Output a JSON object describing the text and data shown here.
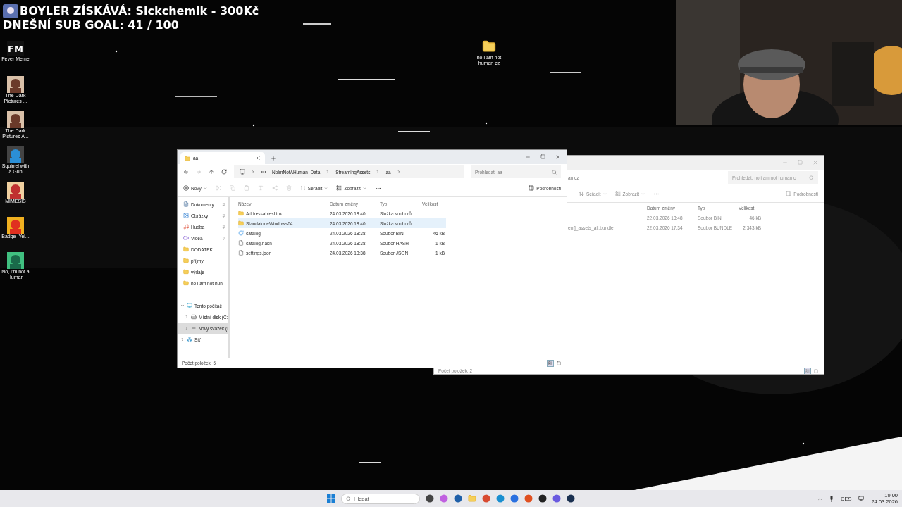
{
  "stream_overlay": {
    "donation_line": "BOYLER ZÍSKÁVÁ: Sickchemik - 300Kč",
    "sub_goal": "DNEŠNÍ SUB GOAL: 41 / 100"
  },
  "desktop_icons": [
    {
      "label": "Fever Meme",
      "kind": "text_logo",
      "logo_text": "FM"
    },
    {
      "label": "The Dark Pictures ...",
      "kind": "picture"
    },
    {
      "label": "The Dark Pictures A...",
      "kind": "picture"
    },
    {
      "label": "Squirrel with a Gun",
      "kind": "picture"
    },
    {
      "label": "MIMESIS",
      "kind": "picture"
    },
    {
      "label": "Badge_Yel...",
      "kind": "picture"
    },
    {
      "label": "No, I'm not a Human",
      "kind": "picture"
    }
  ],
  "desktop_folder": {
    "label": "no i am not human cz"
  },
  "front_window": {
    "tab_title": "aa",
    "breadcrumb": [
      "NoImNotAHuman_Data",
      "StreamingAssets",
      "aa"
    ],
    "search_placeholder": "Prohledat: aa",
    "toolbar": {
      "new": "Nový",
      "sort": "Seřadit",
      "view": "Zobrazit",
      "details": "Podrobnosti"
    },
    "quick_access": [
      {
        "label": "Dokumenty",
        "kind": "documents",
        "pinned": true
      },
      {
        "label": "Obrázky",
        "kind": "pictures",
        "pinned": true
      },
      {
        "label": "Hudba",
        "kind": "music",
        "pinned": true
      },
      {
        "label": "Videa",
        "kind": "videos",
        "pinned": true
      },
      {
        "label": "DODATEK",
        "kind": "folder",
        "pinned": false
      },
      {
        "label": "příjmy",
        "kind": "folder",
        "pinned": false
      },
      {
        "label": "výdaje",
        "kind": "folder",
        "pinned": false
      },
      {
        "label": "no i am not hun",
        "kind": "folder",
        "pinned": false
      }
    ],
    "tree": [
      {
        "label": "Tento počítač",
        "kind": "pc",
        "expanded": true,
        "selected": false,
        "children": [
          {
            "label": "Místní disk (C:",
            "kind": "drive",
            "expanded": false,
            "selected": false
          },
          {
            "label": "Nový svazek (I",
            "kind": "volume",
            "expanded": false,
            "selected": true
          }
        ]
      },
      {
        "label": "Síť",
        "kind": "network",
        "expanded": false,
        "selected": false
      }
    ],
    "columns": [
      "Název",
      "Datum změny",
      "Typ",
      "Velikost"
    ],
    "rows": [
      {
        "name": "AddressablesLink",
        "kind": "folder",
        "date": "24.03.2026 18:40",
        "type": "Složka souborů",
        "size": "",
        "selected": false
      },
      {
        "name": "StandaloneWindows64",
        "kind": "folder",
        "date": "24.03.2026 18:40",
        "type": "Složka souborů",
        "size": "",
        "selected": true
      },
      {
        "name": "catalog",
        "kind": "bin",
        "date": "24.03.2026 18:38",
        "type": "Soubor BIN",
        "size": "46 kB",
        "selected": false
      },
      {
        "name": "catalog.hash",
        "kind": "file",
        "date": "24.03.2026 18:38",
        "type": "Soubor HASH",
        "size": "1 kB",
        "selected": false
      },
      {
        "name": "settings.json",
        "kind": "file",
        "date": "24.03.2026 18:38",
        "type": "Soubor JSON",
        "size": "1 kB",
        "selected": false
      }
    ],
    "status": "Počet položek: 5",
    "view_buttons": [
      {
        "kind": "details",
        "selected": true
      },
      {
        "kind": "tiles",
        "selected": false
      }
    ]
  },
  "back_window": {
    "address_tail": "an cz",
    "search_placeholder": "Prohledat: no i am not human c",
    "toolbar": {
      "sort": "Seřadit",
      "view": "Zobrazit",
      "details": "Podrobnosti"
    },
    "columns": [
      "Datum změny",
      "Typ",
      "Velikost"
    ],
    "rows": [
      {
        "name": "",
        "date": "22.03.2026 18:48",
        "type": "Soubor BIN",
        "size": "46 kB"
      },
      {
        "name": "em]_assets_all.bundle",
        "date": "22.03.2026 17:34",
        "type": "Soubor BUNDLE",
        "size": "2 343 kB"
      }
    ],
    "status": "Počet položek: 2",
    "view_buttons": [
      {
        "kind": "details",
        "selected": true
      },
      {
        "kind": "tiles",
        "selected": false
      }
    ]
  },
  "taskbar": {
    "search_placeholder": "Hledat",
    "language": "CES",
    "time": "19:00",
    "date": "24.03.2026"
  }
}
